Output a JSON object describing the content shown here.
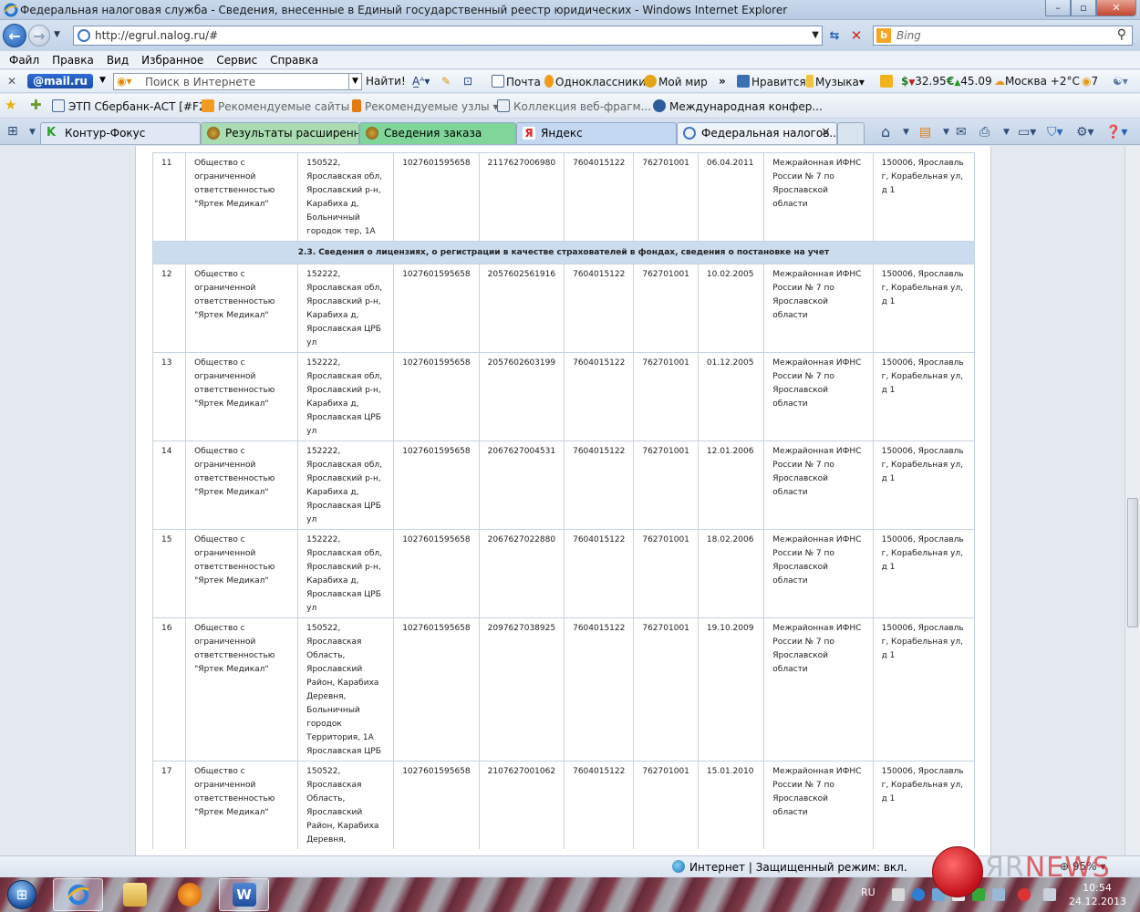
{
  "window": {
    "title": "Федеральная налоговая служба - Сведения, внесенные в Единый государственный реестр юридических  - Windows Internet Explorer",
    "minimize": "–",
    "maximize": "▫",
    "close": "✕"
  },
  "address": {
    "url": "http://egrul.nalog.ru/#",
    "search_placeholder": "Bing"
  },
  "menu": [
    "Файл",
    "Правка",
    "Вид",
    "Избранное",
    "Сервис",
    "Справка"
  ],
  "mail_toolbar": {
    "logo": "@mail.ru",
    "search_placeholder": "Поиск в Интернете",
    "find_label": "Найти!",
    "pochta": "Почта",
    "odnoklassniki": "Одноклассники",
    "moi_mir": "Мой мир",
    "nravitsya": "Нравится",
    "muzyka": "Музыка",
    "usd": "32.95",
    "eur": "45.09",
    "weather": "Москва +2°C",
    "count": "7"
  },
  "favorites": {
    "items": [
      "ЭТП Сбербанк-АСТ [#F2]",
      "Рекомендуемые сайты",
      "Рекомендуемые узлы",
      "Коллекция веб-фрагм...",
      "Международная конфер..."
    ]
  },
  "tabs": [
    {
      "label": "Контур-Фокус",
      "color": "#dfe8f3"
    },
    {
      "label": "Результаты расширенног...",
      "color": "#a9dcb0"
    },
    {
      "label": "Сведения заказа",
      "color": "#7fd59a"
    },
    {
      "label": "Яндекс",
      "color": "#c5d8f1"
    },
    {
      "label": "Федеральная налогов...",
      "color": "#eef3fa"
    }
  ],
  "section_header": "2.3. Сведения о лицензиях, о регистрации в качестве страхователей в фондах, сведения о постановке на учет",
  "rows": [
    {
      "num": "11",
      "name": "Общество с ограниченной ответственностью \"Яртек Медикал\"",
      "addr": "150522, Ярославская обл, Ярославский р-н, Карабиха д, Больничный городок тер, 1А",
      "ogrn": "1027601595658",
      "grn": "2117627006980",
      "inn": "7604015122",
      "kpp": "762701001",
      "date": "06.04.2011",
      "org": "Межрайонная ИФНС России № 7 по Ярославской области",
      "org_addr": "150006, Ярославль г, Корабельная ул, д 1"
    },
    {
      "num": "12",
      "name": "Общество с ограниченной ответственностью \"Яртек Медикал\"",
      "addr": "152222, Ярославская обл, Ярославский р-н, Карабиха д, Ярославская ЦРБ ул",
      "ogrn": "1027601595658",
      "grn": "2057602561916",
      "inn": "7604015122",
      "kpp": "762701001",
      "date": "10.02.2005",
      "org": "Межрайонная ИФНС России № 7 по Ярославской области",
      "org_addr": "150006, Ярославль г, Корабельная ул, д 1"
    },
    {
      "num": "13",
      "name": "Общество с ограниченной ответственностью \"Яртек Медикал\"",
      "addr": "152222, Ярославская обл, Ярославский р-н, Карабиха д, Ярославская ЦРБ ул",
      "ogrn": "1027601595658",
      "grn": "2057602603199",
      "inn": "7604015122",
      "kpp": "762701001",
      "date": "01.12.2005",
      "org": "Межрайонная ИФНС России № 7 по Ярославской области",
      "org_addr": "150006, Ярославль г, Корабельная ул, д 1"
    },
    {
      "num": "14",
      "name": "Общество с ограниченной ответственностью \"Яртек Медикал\"",
      "addr": "152222, Ярославская обл, Ярославский р-н, Карабиха д, Ярославская ЦРБ ул",
      "ogrn": "1027601595658",
      "grn": "2067627004531",
      "inn": "7604015122",
      "kpp": "762701001",
      "date": "12.01.2006",
      "org": "Межрайонная ИФНС России № 7 по Ярославской области",
      "org_addr": "150006, Ярославль г, Корабельная ул, д 1"
    },
    {
      "num": "15",
      "name": "Общество с ограниченной ответственностью \"Яртек Медикал\"",
      "addr": "152222, Ярославская обл, Ярославский р-н, Карабиха д, Ярославская ЦРБ ул",
      "ogrn": "1027601595658",
      "grn": "2067627022880",
      "inn": "7604015122",
      "kpp": "762701001",
      "date": "18.02.2006",
      "org": "Межрайонная ИФНС России № 7 по Ярославской области",
      "org_addr": "150006, Ярославль г, Корабельная ул, д 1"
    },
    {
      "num": "16",
      "name": "Общество с ограниченной ответственностью \"Яртек Медикал\"",
      "addr": "150522, Ярославская Область, Ярославский Район, Карабиха Деревня, Больничный городок Территория, 1А Ярославская ЦРБ",
      "ogrn": "1027601595658",
      "grn": "2097627038925",
      "inn": "7604015122",
      "kpp": "762701001",
      "date": "19.10.2009",
      "org": "Межрайонная ИФНС России № 7 по Ярославской области",
      "org_addr": "150006, Ярославль г, Корабельная ул, д 1"
    },
    {
      "num": "17",
      "name": "Общество с ограниченной ответственностью \"Яртек Медикал\"",
      "addr": "150522, Ярославская Область, Ярославский Район, Карабиха Деревня,",
      "ogrn": "1027601595658",
      "grn": "2107627001062",
      "inn": "7604015122",
      "kpp": "762701001",
      "date": "15.01.2010",
      "org": "Межрайонная ИФНС России № 7 по Ярославской области",
      "org_addr": "150006, Ярославль г, Корабельная ул, д 1"
    }
  ],
  "status": {
    "zone": "Интернет | Защищенный режим: вкл.",
    "zoom": "95%"
  },
  "taskbar": {
    "lang": "RU",
    "time": "10:54",
    "date": "24.12.2013"
  },
  "watermark": {
    "brand_a": "ЯR",
    "brand_b": "NEWS"
  }
}
